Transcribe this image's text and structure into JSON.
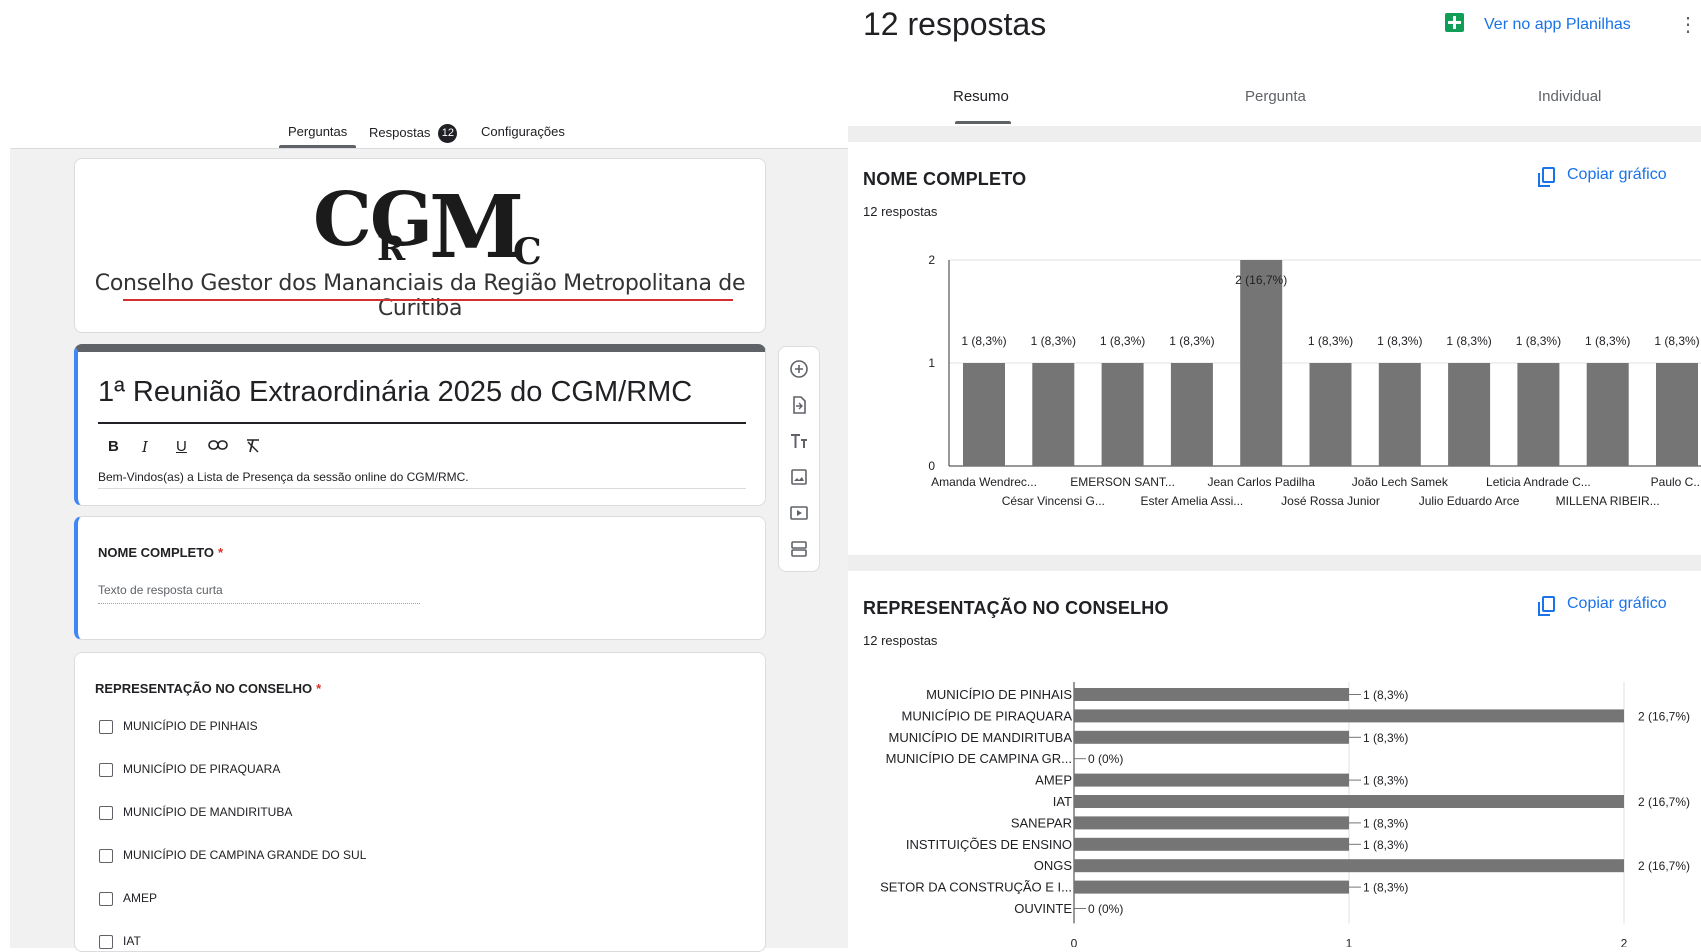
{
  "form": {
    "tabs": [
      {
        "label": "Perguntas"
      },
      {
        "label": "Respostas",
        "badge": "12"
      },
      {
        "label": "Configurações"
      }
    ],
    "logo": {
      "cg": "CG",
      "m": "M",
      "r": "R",
      "c": "C",
      "subtitle": "Conselho Gestor dos Mananciais da Região Metropolitana de Curitiba"
    },
    "title": "1ª Reunião Extraordinária 2025 do CGM/RMC",
    "format_tools": [
      "B",
      "I",
      "U",
      "link",
      "clear-format"
    ],
    "description": "Bem-Vindos(as) a Lista de Presença da sessão online do CGM/RMC.",
    "question1": {
      "title": "NOME COMPLETO",
      "required_mark": "*",
      "placeholder": "Texto de resposta curta"
    },
    "question2": {
      "title": "REPRESENTAÇÃO NO CONSELHO",
      "required_mark": "*",
      "options": [
        "MUNICÍPIO DE PINHAIS",
        "MUNICÍPIO DE PIRAQUARA",
        "MUNICÍPIO DE MANDIRITUBA",
        "MUNICÍPIO DE CAMPINA GRANDE DO SUL",
        "AMEP",
        "IAT"
      ]
    },
    "toolbar_icons": [
      "add-question-icon",
      "import-questions-icon",
      "add-title-icon",
      "add-image-icon",
      "add-video-icon",
      "add-section-icon"
    ]
  },
  "responses": {
    "title": "12 respostas",
    "sheets_link": "Ver no app Planilhas",
    "tabs": [
      "Resumo",
      "Pergunta",
      "Individual"
    ],
    "copy_label": "Copiar gráfico"
  },
  "chart_data": [
    {
      "type": "bar",
      "title": "NOME COMPLETO",
      "subtitle": "12 respostas",
      "categories": [
        "Amanda Wendrec...",
        "César Vincensi G...",
        "EMERSON SANT...",
        "Ester Amelia Assi...",
        "Jean Carlos Padilha",
        "José Rossa Junior",
        "João Lech Samek",
        "Julio Eduardo Arce",
        "Leticia Andrade C...",
        "MILLENA RIBEIR...",
        "Paulo C..."
      ],
      "values": [
        1,
        1,
        1,
        1,
        2,
        1,
        1,
        1,
        1,
        1,
        1
      ],
      "data_labels": [
        "1 (8,3%)",
        "1 (8,3%)",
        "1 (8,3%)",
        "1 (8,3%)",
        "2 (16,7%)",
        "1 (8,3%)",
        "1 (8,3%)",
        "1 (8,3%)",
        "1 (8,3%)",
        "1 (8,3%)",
        "1 (8,3%)"
      ],
      "yticks": [
        "0",
        "1",
        "2"
      ],
      "ylim": [
        0,
        2
      ],
      "color": "#757575"
    },
    {
      "type": "bar",
      "orientation": "horizontal",
      "title": "REPRESENTAÇÃO NO CONSELHO",
      "subtitle": "12 respostas",
      "categories": [
        "MUNICÍPIO DE PINHAIS",
        "MUNICÍPIO DE PIRAQUARA",
        "MUNICÍPIO DE MANDIRITUBA",
        "MUNICÍPIO DE CAMPINA GR...",
        "AMEP",
        "IAT",
        "SANEPAR",
        "INSTITUIÇÕES DE ENSINO",
        "ONGS",
        "SETOR DA CONSTRUÇÃO E I...",
        "OUVINTE"
      ],
      "values": [
        1,
        2,
        1,
        0,
        1,
        2,
        1,
        1,
        2,
        1,
        0
      ],
      "data_labels": [
        "1 (8,3%)",
        "2 (16,7%)",
        "1 (8,3%)",
        "0 (0%)",
        "1 (8,3%)",
        "2 (16,7%)",
        "1 (8,3%)",
        "1 (8,3%)",
        "2 (16,7%)",
        "1 (8,3%)",
        "0 (0%)"
      ],
      "xticks": [
        "0",
        "1",
        "2"
      ],
      "xlim": [
        0,
        2
      ],
      "color": "#757575"
    }
  ]
}
